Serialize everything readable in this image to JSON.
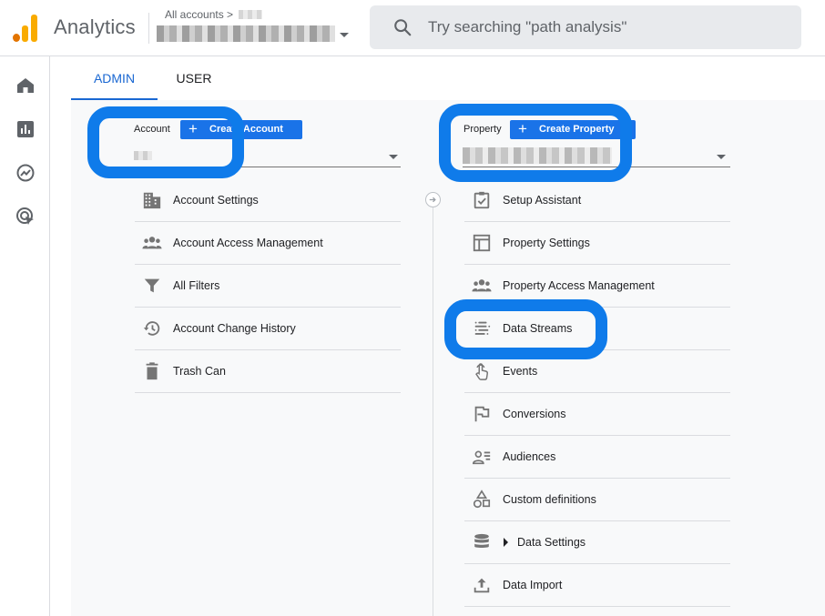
{
  "header": {
    "app_title": "Analytics",
    "breadcrumb": "All accounts >",
    "search_placeholder": "Try searching \"path analysis\""
  },
  "tabs": [
    {
      "label": "ADMIN",
      "active": true
    },
    {
      "label": "USER",
      "active": false
    }
  ],
  "account_column": {
    "label": "Account",
    "create_button": "Create Account",
    "items": [
      {
        "label": "Account Settings",
        "icon": "building-icon"
      },
      {
        "label": "Account Access Management",
        "icon": "people-icon"
      },
      {
        "label": "All Filters",
        "icon": "filter-icon"
      },
      {
        "label": "Account Change History",
        "icon": "history-icon"
      },
      {
        "label": "Trash Can",
        "icon": "trash-icon"
      }
    ]
  },
  "property_column": {
    "label": "Property",
    "create_button": "Create Property",
    "items": [
      {
        "label": "Setup Assistant",
        "icon": "checklist-icon"
      },
      {
        "label": "Property Settings",
        "icon": "layout-icon"
      },
      {
        "label": "Property Access Management",
        "icon": "people-icon"
      },
      {
        "label": "Data Streams",
        "icon": "streams-icon"
      },
      {
        "label": "Events",
        "icon": "touch-icon"
      },
      {
        "label": "Conversions",
        "icon": "flag-icon"
      },
      {
        "label": "Audiences",
        "icon": "audience-icon"
      },
      {
        "label": "Custom definitions",
        "icon": "shapes-icon"
      },
      {
        "label": "Data Settings",
        "icon": "database-icon"
      },
      {
        "label": "Data Import",
        "icon": "upload-icon"
      }
    ]
  },
  "colors": {
    "accent": "#1a73e8",
    "highlight": "#0f7bea",
    "logo_orange": "#e37400",
    "logo_yellow": "#f9ab00"
  }
}
